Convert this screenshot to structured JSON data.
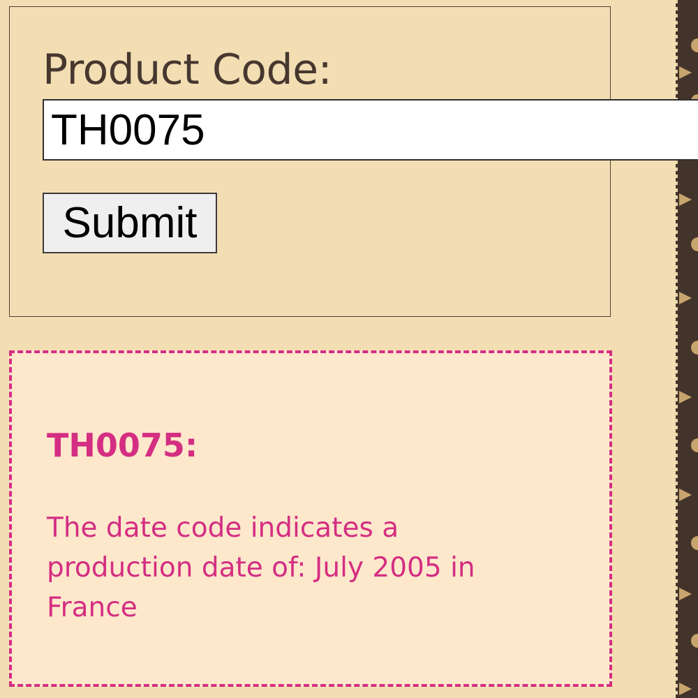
{
  "form": {
    "label": "Product Code:",
    "input_value": "TH0075",
    "submit_label": "Submit"
  },
  "result": {
    "title": "TH0075:",
    "message": "The date code indicates a production date of: July 2005 in France"
  },
  "colors": {
    "page_background": "#f3deb4",
    "result_background": "#fde8cc",
    "accent": "#d42e82",
    "label_text": "#46382f",
    "strip": "#43342b",
    "strip_pattern": "#c8a46e"
  },
  "icons": {
    "side_strip": "monogram-pattern"
  }
}
